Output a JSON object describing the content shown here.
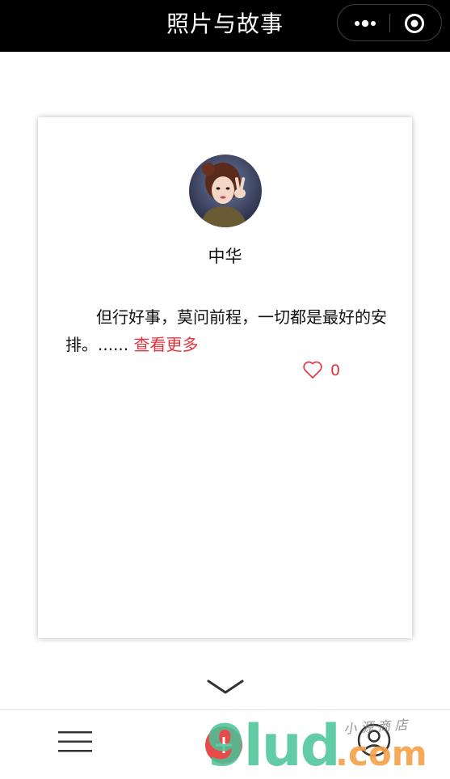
{
  "header": {
    "title": "照片与故事",
    "capsule": {
      "more_icon": "more-dots-icon",
      "close_icon": "target-circle-icon"
    }
  },
  "card": {
    "author": "中华",
    "story": "但行好事，莫问前程，一切都是最好的安排。......",
    "read_more": "查看更多",
    "like_count": "0",
    "like_icon": "heart-outline-icon"
  },
  "scroll_indicator": {
    "icon": "chevron-down-icon"
  },
  "bottom_bar": {
    "menu_icon": "hamburger-menu-icon",
    "add_icon": "add-icon",
    "user_icon": "user-profile-icon"
  },
  "watermark": {
    "brand": "9lud",
    "tld": ".com",
    "tagline": "小 源 商 店"
  },
  "colors": {
    "header_bg": "#000000",
    "accent_red": "#e8313c",
    "text": "#111111"
  }
}
